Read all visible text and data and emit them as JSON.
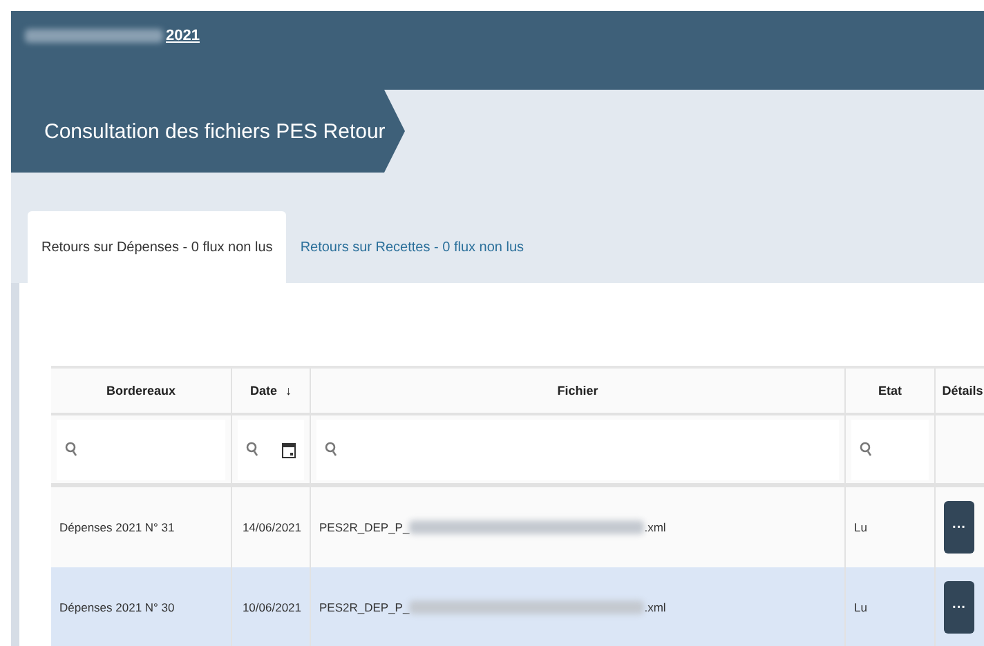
{
  "breadcrumb": {
    "year": "2021"
  },
  "page_title": "Consultation des fichiers PES Retour",
  "tabs": [
    {
      "label": "Retours sur Dépenses - 0 flux non lus",
      "selected": true
    },
    {
      "label": "Retours sur Recettes - 0 flux non lus",
      "selected": false
    }
  ],
  "table": {
    "columns": [
      {
        "label": "Bordereaux",
        "kind": "text"
      },
      {
        "label": "Date",
        "sort": "↓",
        "kind": "date"
      },
      {
        "label": "Fichier",
        "kind": "text"
      },
      {
        "label": "Etat",
        "kind": "text"
      },
      {
        "label": "Détails",
        "kind": "action"
      }
    ],
    "rows": [
      {
        "bordereau": "Dépenses 2021 N° 31",
        "date": "14/06/2021",
        "file_prefix": "PES2R_DEP_P_",
        "file_suffix": ".xml",
        "etat": "Lu",
        "details": "···",
        "selected": false
      },
      {
        "bordereau": "Dépenses 2021 N° 30",
        "date": "10/06/2021",
        "file_prefix": "PES2R_DEP_P_",
        "file_suffix": ".xml",
        "etat": "Lu",
        "details": "···",
        "selected": true
      }
    ]
  }
}
